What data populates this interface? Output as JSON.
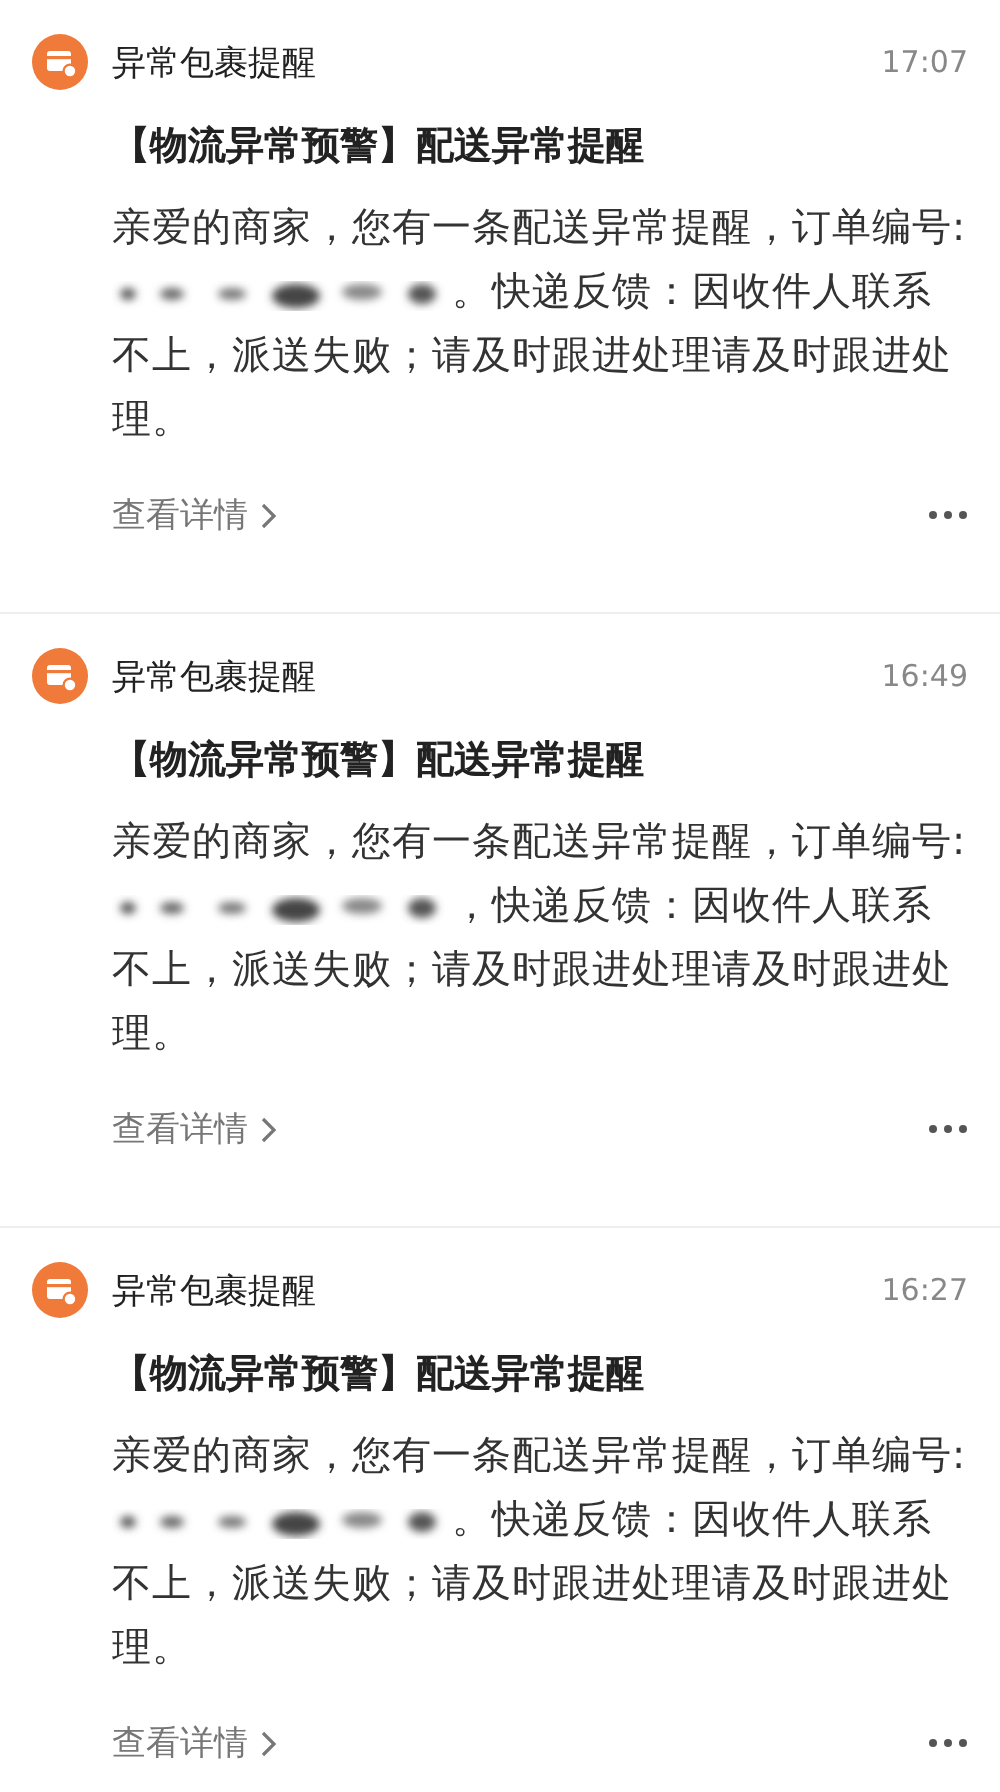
{
  "messages": [
    {
      "sender": "异常包裹提醒",
      "time": "17:07",
      "heading": "【物流异常预警】配送异常提醒",
      "text_before": "亲爱的商家，您有一条配送异常提醒，订单编号:",
      "text_after": "。快递反馈：因收件人联系",
      "text_end": "不上，派送失败；请及时跟进处理请及时跟进处理。",
      "link": "查看详情"
    },
    {
      "sender": "异常包裹提醒",
      "time": "16:49",
      "heading": "【物流异常预警】配送异常提醒",
      "text_before": "亲爱的商家，您有一条配送异常提醒，订单编号:",
      "text_after": "，快递反馈：因收件人联系",
      "text_end": "不上，派送失败；请及时跟进处理请及时跟进处理。",
      "link": "查看详情"
    },
    {
      "sender": "异常包裹提醒",
      "time": "16:27",
      "heading": "【物流异常预警】配送异常提醒",
      "text_before": "亲爱的商家，您有一条配送异常提醒，订单编号:",
      "text_after": "。快递反馈：因收件人联系",
      "text_end": "不上，派送失败；请及时跟进处理请及时跟进处理。",
      "link": "查看详情"
    }
  ]
}
